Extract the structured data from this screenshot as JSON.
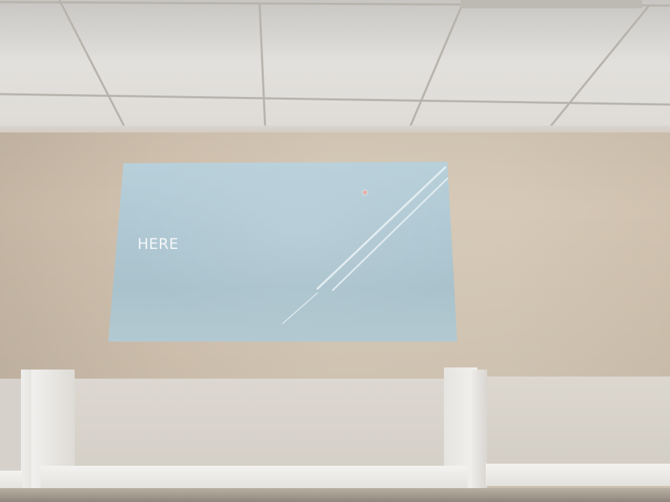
{
  "slide": {
    "text": "HERE"
  }
}
